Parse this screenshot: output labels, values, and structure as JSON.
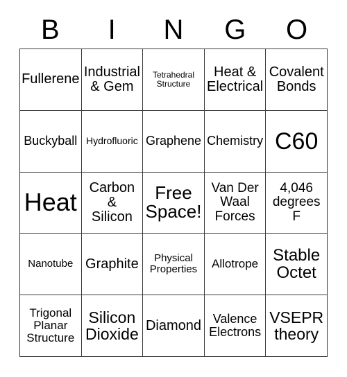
{
  "card": {
    "title_letters": [
      "B",
      "I",
      "N",
      "G",
      "O"
    ],
    "grid_size": "5x5",
    "free_space_label": "Free\nSpace!",
    "colors": {
      "background": "#ffffff",
      "text": "#000000",
      "gridline": "#3a3a3a"
    },
    "rows": [
      [
        {
          "text": "Fullerene",
          "size": "fs-xl"
        },
        {
          "text": "Industrial\n& Gem",
          "size": "fs-xl"
        },
        {
          "text": "Tetrahedral\nStructure",
          "size": "fs-xs"
        },
        {
          "text": "Heat &\nElectrical",
          "size": "fs-xl"
        },
        {
          "text": "Covalent\nBonds",
          "size": "fs-xl"
        }
      ],
      [
        {
          "text": "Buckyball",
          "size": "fs-ml"
        },
        {
          "text": "Hydrofluoric",
          "size": "fs-s"
        },
        {
          "text": "Graphene",
          "size": "fs-ml"
        },
        {
          "text": "Chemistry",
          "size": "fs-ml"
        },
        {
          "text": "C60",
          "size": "fs-h3"
        }
      ],
      [
        {
          "text": "Heat",
          "size": "fs-h4"
        },
        {
          "text": "Carbon\n&\nSilicon",
          "size": "fs-xl"
        },
        {
          "text": "Free\nSpace!",
          "size": "fs-h2"
        },
        {
          "text": "Van Der\nWaal\nForces",
          "size": "fs-l"
        },
        {
          "text": "4,046\ndegrees\nF",
          "size": "fs-l"
        }
      ],
      [
        {
          "text": "Nanotube",
          "size": "fs-sm"
        },
        {
          "text": "Graphite",
          "size": "fs-xl"
        },
        {
          "text": "Physical\nProperties",
          "size": "fs-sm"
        },
        {
          "text": "Allotrope",
          "size": "fs-m"
        },
        {
          "text": "Stable\nOctet",
          "size": "fs-h1"
        }
      ],
      [
        {
          "text": "Trigonal\nPlanar\nStructure",
          "size": "fs-m"
        },
        {
          "text": "Silicon\nDioxide",
          "size": "fs-xxl"
        },
        {
          "text": "Diamond",
          "size": "fs-xl"
        },
        {
          "text": "Valence\nElectrons",
          "size": "fs-ml"
        },
        {
          "text": "VSEPR\ntheory",
          "size": "fs-xxl"
        }
      ]
    ]
  }
}
